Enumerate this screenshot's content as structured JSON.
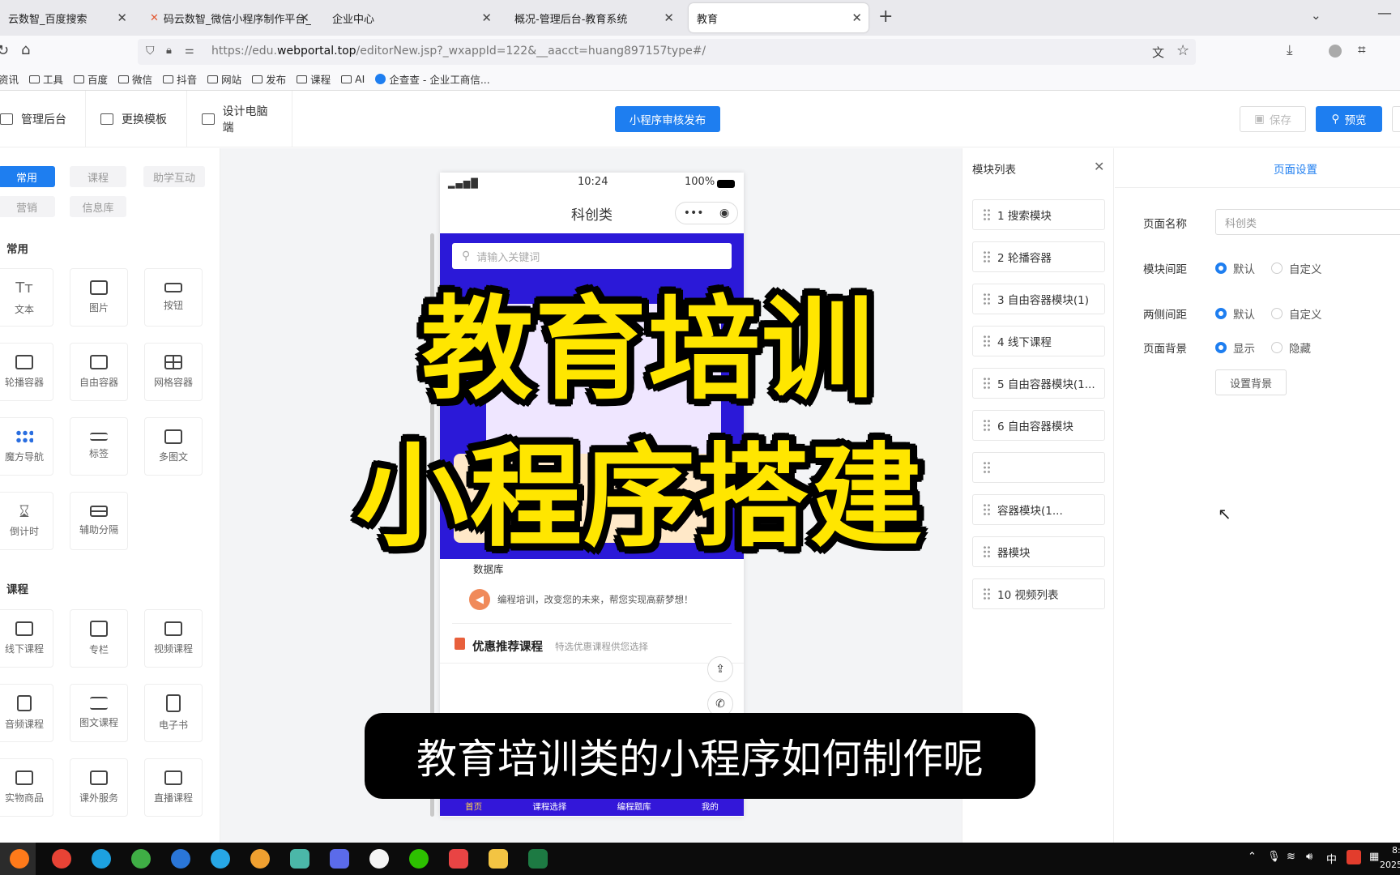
{
  "browser": {
    "tabs": [
      {
        "label": "云数智_百度搜索"
      },
      {
        "label": "码云数智_微信小程序制作平台_"
      },
      {
        "label": "企业中心"
      },
      {
        "label": "概况-管理后台-教育系统"
      },
      {
        "label": "教育"
      }
    ],
    "new_tab": "+",
    "url_prefix": "https://edu.",
    "url_domain": "webportal.top",
    "url_rest": "/editorNew.jsp?_wxappId=122&__aacct=huang897157type#/",
    "bookmarks": [
      "资讯",
      "工具",
      "百度",
      "微信",
      "抖音",
      "网站",
      "发布",
      "课程",
      "AI",
      "企查查 - 企业工商信..."
    ]
  },
  "header": {
    "admin": "管理后台",
    "template": "更换模板",
    "pc": "设计电脑端",
    "publish": "小程序审核发布",
    "save": "保存",
    "preview": "预览"
  },
  "left": {
    "categories": [
      "常用",
      "课程",
      "助学互动",
      "营销",
      "信息库"
    ],
    "section_common": "常用",
    "common": [
      "文本",
      "图片",
      "按钮",
      "轮播容器",
      "自由容器",
      "网格容器",
      "魔方导航",
      "标签",
      "多图文",
      "倒计时",
      "辅助分隔"
    ],
    "section_course": "课程",
    "course": [
      "线下课程",
      "专栏",
      "视频课程",
      "音频课程",
      "图文课程",
      "电子书",
      "实物商品",
      "课外服务",
      "直播课程"
    ]
  },
  "phone": {
    "time": "10:24",
    "battery": "100%",
    "title": "科创类",
    "search_placeholder": "请输入关键词",
    "db_label": "数据库",
    "notice": "编程培训，改变您的未来，帮您实现高薪梦想！",
    "rec_title": "优惠推荐课程",
    "rec_sub": "特选优惠课程供您选择",
    "nav": [
      "首页",
      "课程选择",
      "编程题库",
      "我的"
    ]
  },
  "modules": {
    "title": "模块列表",
    "items": [
      "1 搜索模块",
      "2 轮播容器",
      "3 自由容器模块(1)",
      "4 线下课程",
      "5 自由容器模块(1...",
      "6 自由容器模块",
      "",
      "容器模块(1...",
      "器模块",
      "10 视频列表"
    ]
  },
  "settings": {
    "tab": "页面设置",
    "name_label": "页面名称",
    "name_value": "科创类",
    "spacing_label": "模块间距",
    "side_label": "两侧间距",
    "bg_label": "页面背景",
    "default": "默认",
    "custom": "自定义",
    "show": "显示",
    "hide": "隐藏",
    "set_bg": "设置背景"
  },
  "overlay": {
    "line1": "教育培训",
    "line2": "小程序搭建",
    "subtitle": "教育培训类的小程序如何制作呢"
  },
  "taskbar": {
    "ime": "中",
    "clock_time": "8:",
    "clock_date": "2025"
  },
  "colors": {
    "accent": "#1e7ef0",
    "overlay_yellow": "#ffe600",
    "phone_banner": "#2b19d8"
  }
}
